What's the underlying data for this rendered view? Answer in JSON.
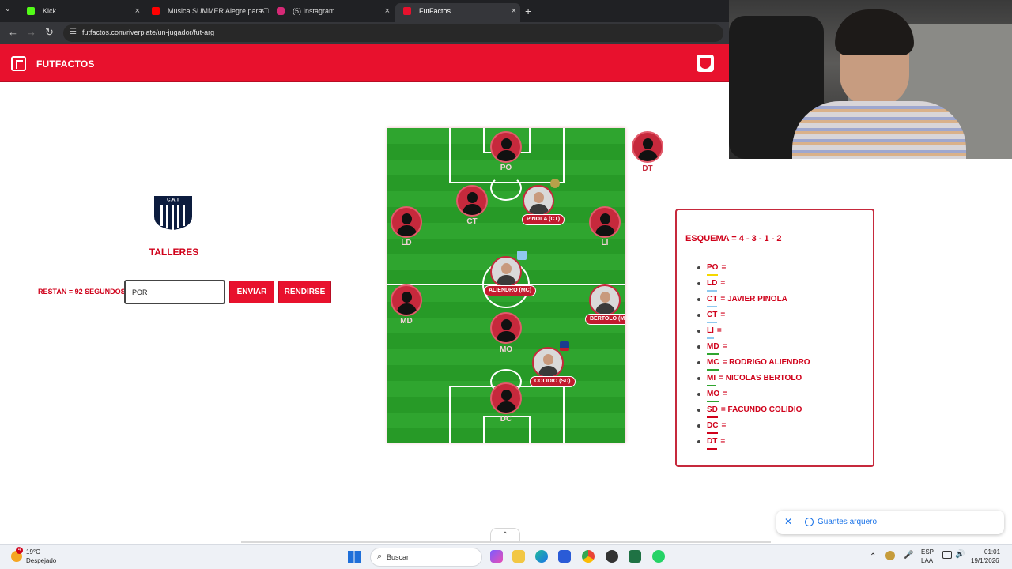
{
  "browser": {
    "tabs": [
      {
        "title": "Kick",
        "icon": "kick-icon",
        "color": "#53fc18",
        "active": false
      },
      {
        "title": "Música SUMMER Alegre para Tr",
        "icon": "youtube-icon",
        "color": "#ff0000",
        "active": false
      },
      {
        "title": "(5) Instagram",
        "icon": "instagram-icon",
        "color": "#d62976",
        "active": false
      },
      {
        "title": "FutFactos",
        "icon": "futfactos-icon",
        "color": "#e8112d",
        "active": true
      }
    ],
    "url": "futfactos.com/riverplate/un-jugador/fut-arg"
  },
  "site": {
    "brand": "FUTFACTOS",
    "accent_color": "#e8112d"
  },
  "club": {
    "name": "TALLERES",
    "crest_letters": "C.A.T"
  },
  "game": {
    "timer_text": "RESTAN = 92 SEGUNDOS",
    "input_value": "POR",
    "send_label": "ENVIAR",
    "give_up_label": "RENDIRSE"
  },
  "pitch": {
    "po": "PO",
    "ct_left": "CT",
    "ct_right_pill": "PINOLA (CT)",
    "ld": "LD",
    "li": "LI",
    "mc_pill": "ALIENDRO (MC)",
    "md": "MD",
    "mi_pill": "BERTOLO (MI)",
    "mo": "MO",
    "sd_pill": "COLIDIO (SD)",
    "dc": "DC",
    "dt": "DT"
  },
  "formation": {
    "scheme": "ESQUEMA = 4 - 3 - 1 - 2",
    "rows": [
      {
        "code": "PO",
        "name": "=",
        "bar": "#f5d800"
      },
      {
        "code": "LD",
        "name": "=",
        "bar": "#8fc9ef"
      },
      {
        "code": "CT",
        "name": "= JAVIER PINOLA",
        "bar": "#8fc9ef"
      },
      {
        "code": "CT",
        "name": "=",
        "bar": "#8fc9ef"
      },
      {
        "code": "LI",
        "name": "=",
        "bar": "#8fc9ef"
      },
      {
        "code": "MD",
        "name": "=",
        "bar": "#2fa52f"
      },
      {
        "code": "MC",
        "name": "= RODRIGO ALIENDRO",
        "bar": "#2fa52f"
      },
      {
        "code": "MI",
        "name": "= NICOLAS BERTOLO",
        "bar": "#2fa52f"
      },
      {
        "code": "MO",
        "name": "=",
        "bar": "#2fa52f"
      },
      {
        "code": "SD",
        "name": "= FACUNDO COLIDIO",
        "bar": "#d0021b"
      },
      {
        "code": "DC",
        "name": "=",
        "bar": "#d0021b"
      },
      {
        "code": "DT",
        "name": "=",
        "bar": "#d0021b"
      }
    ]
  },
  "notification": {
    "text": "Guantes arquero"
  },
  "taskbar": {
    "temp": "19°C",
    "weather": "Despejado",
    "search_placeholder": "Buscar",
    "lang_top": "ESP",
    "lang_bottom": "LAA",
    "time": "01:01",
    "date": "19/1/2026",
    "badge_count": "4"
  }
}
